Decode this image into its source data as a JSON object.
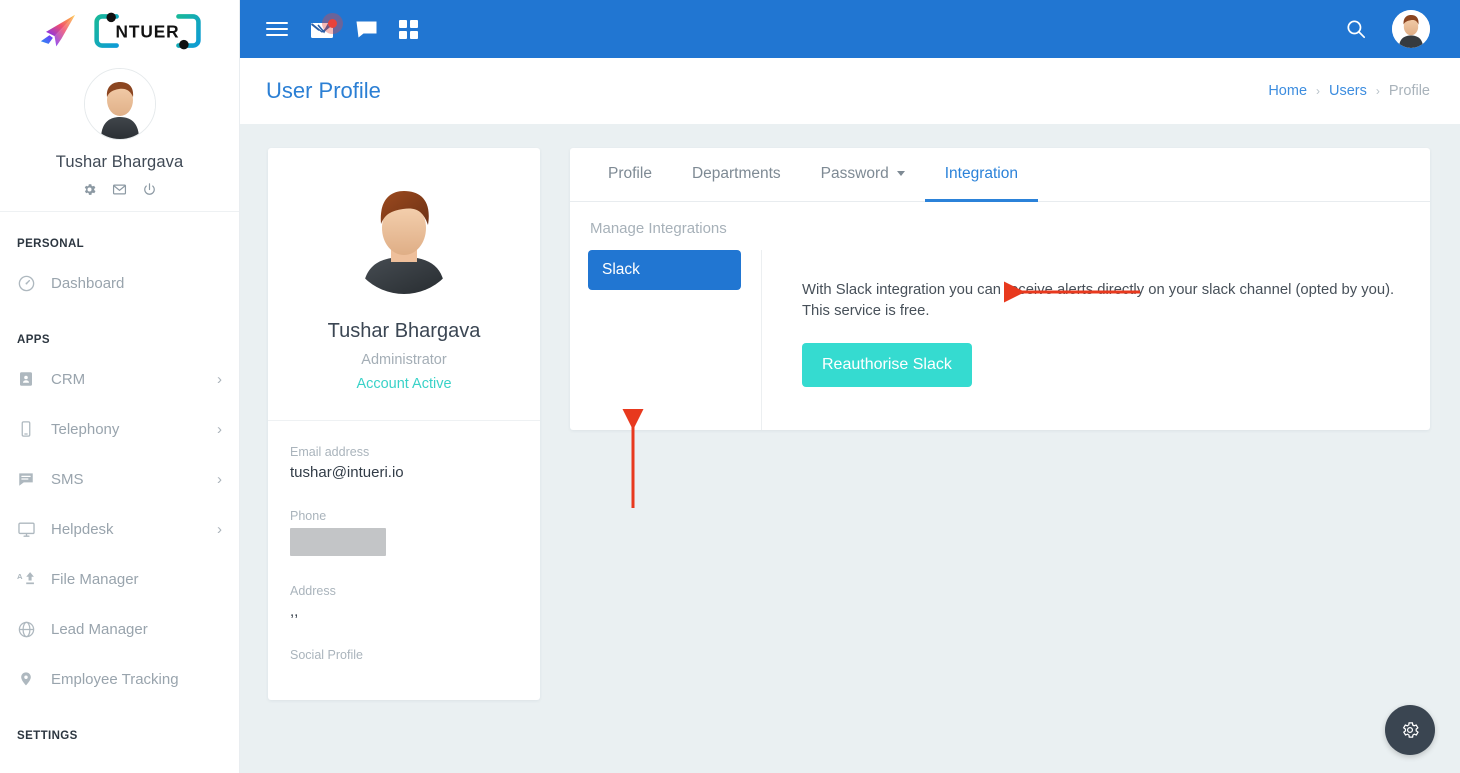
{
  "brand": {
    "logo_word": "iNTUERi",
    "plane_icon": "paper-plane-icon"
  },
  "sidebar": {
    "user_name": "Tushar Bhargava",
    "quick_icons": [
      {
        "name": "gear-icon",
        "label": "Settings"
      },
      {
        "name": "mail-icon",
        "label": "Mail"
      },
      {
        "name": "power-icon",
        "label": "Logout"
      }
    ],
    "sections": [
      {
        "title": "PERSONAL",
        "items": [
          {
            "label": "Dashboard",
            "icon": "dashboard-icon",
            "has_arrow": false
          }
        ]
      },
      {
        "title": "APPS",
        "items": [
          {
            "label": "CRM",
            "icon": "contact-card-icon",
            "has_arrow": true
          },
          {
            "label": "Telephony",
            "icon": "phone-icon",
            "has_arrow": true
          },
          {
            "label": "SMS",
            "icon": "message-icon",
            "has_arrow": true
          },
          {
            "label": "Helpdesk",
            "icon": "monitor-icon",
            "has_arrow": true
          },
          {
            "label": "File Manager",
            "icon": "file-upload-icon",
            "has_arrow": false
          },
          {
            "label": "Lead Manager",
            "icon": "globe-icon",
            "has_arrow": false
          },
          {
            "label": "Employee Tracking",
            "icon": "map-pin-icon",
            "has_arrow": false
          }
        ]
      },
      {
        "title": "SETTINGS",
        "items": []
      }
    ]
  },
  "topbar": {
    "background": "#2176d2",
    "icons": [
      {
        "name": "hamburger-menu-icon",
        "label": "Toggle menu"
      },
      {
        "name": "mail-envelope-icon",
        "label": "Messages",
        "badge": true
      },
      {
        "name": "chat-bubble-icon",
        "label": "Chat"
      },
      {
        "name": "grid-apps-icon",
        "label": "Apps"
      }
    ],
    "search_icon": "search-icon",
    "avatar": "user-avatar"
  },
  "page": {
    "title": "User Profile",
    "title_color": "#2b7fd4",
    "breadcrumb": [
      {
        "label": "Home",
        "link": true
      },
      {
        "label": "Users",
        "link": true
      },
      {
        "label": "Profile",
        "link": false
      }
    ],
    "breadcrumb_separator": "›"
  },
  "profile_card": {
    "avatar": "user-avatar-large",
    "name": "Tushar Bhargava",
    "role": "Administrator",
    "status": "Account Active",
    "status_color": "#3ad2c8",
    "fields": [
      {
        "label": "Email address",
        "value": "tushar@intueri.io",
        "redacted": false
      },
      {
        "label": "Phone",
        "value": "",
        "redacted": true
      },
      {
        "label": "Address",
        "value": ",,",
        "redacted": false
      },
      {
        "label": "Social Profile",
        "value": "",
        "redacted": false
      }
    ]
  },
  "tabs": [
    {
      "label": "Profile",
      "active": false,
      "dropdown": false
    },
    {
      "label": "Departments",
      "active": false,
      "dropdown": false
    },
    {
      "label": "Password",
      "active": false,
      "dropdown": true
    },
    {
      "label": "Integration",
      "active": true,
      "dropdown": false
    }
  ],
  "integration": {
    "heading": "Manage Integrations",
    "providers": [
      {
        "label": "Slack",
        "selected": true,
        "color": "#2176d2"
      }
    ],
    "description": "With Slack integration you can receive alerts directly on your slack channel (opted by you). This service is free.",
    "action_label": "Reauthorise Slack",
    "action_color": "#35dbd0"
  },
  "fab": {
    "icon": "gear-icon",
    "color": "#3a4551"
  },
  "annotations": [
    {
      "name": "arrow-pointing-to-integration-tab",
      "direction": "left",
      "color": "#e8391e"
    },
    {
      "name": "arrow-pointing-to-slack-button",
      "direction": "up",
      "color": "#e8391e"
    }
  ]
}
